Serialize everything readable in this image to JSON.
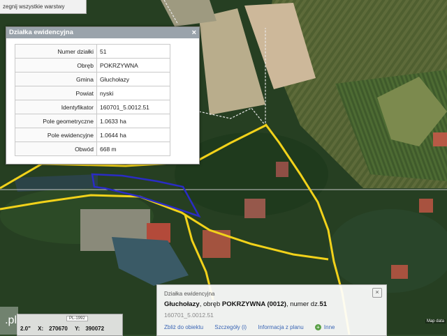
{
  "toolbar": {
    "hint": "zegnij wszystkie warstwy"
  },
  "parcel_window": {
    "title": "Działka ewidencyjna",
    "close_label": "×",
    "rows": [
      {
        "key": "Numer działki",
        "value": "51"
      },
      {
        "key": "Obręb",
        "value": "POKRZYWNA"
      },
      {
        "key": "Gmina",
        "value": "Głuchołazy"
      },
      {
        "key": "Powiat",
        "value": "nyski"
      },
      {
        "key": "Identyfikator",
        "value": "160701_5.0012.51"
      },
      {
        "key": "Pole geometryczne",
        "value": "1.0633 ha"
      },
      {
        "key": "Pole ewidencyjne",
        "value": "1.0644 ha"
      },
      {
        "key": "Obwód",
        "value": "668 m"
      }
    ]
  },
  "popup": {
    "title": "Działka ewidencyjna",
    "close_label": "×",
    "place": "Głuchołazy",
    "precinct_prefix": ", obręb ",
    "precinct": "POKRZYWNA (0012)",
    "number_prefix": ", numer dz.",
    "number": "51",
    "identifier": "160701_5.0012.51",
    "links": {
      "zoom": "Zbliż do obiektu",
      "details": "Szczegóły (i)",
      "info": "Informacja z planu",
      "more": "Inne"
    }
  },
  "coords": {
    "system": "PL-1992",
    "prefix": "2.0\"",
    "x_label": "X:",
    "x_value": "270670",
    "y_label": "Y:",
    "y_value": "390072"
  },
  "watermark": ".pl",
  "map_credit": "Map data",
  "colors": {
    "road_yellow": "#f2d21a",
    "parcel_blue": "#2a2cc4",
    "header_gray": "#9aa3ab",
    "link_blue": "#3b66b5"
  }
}
